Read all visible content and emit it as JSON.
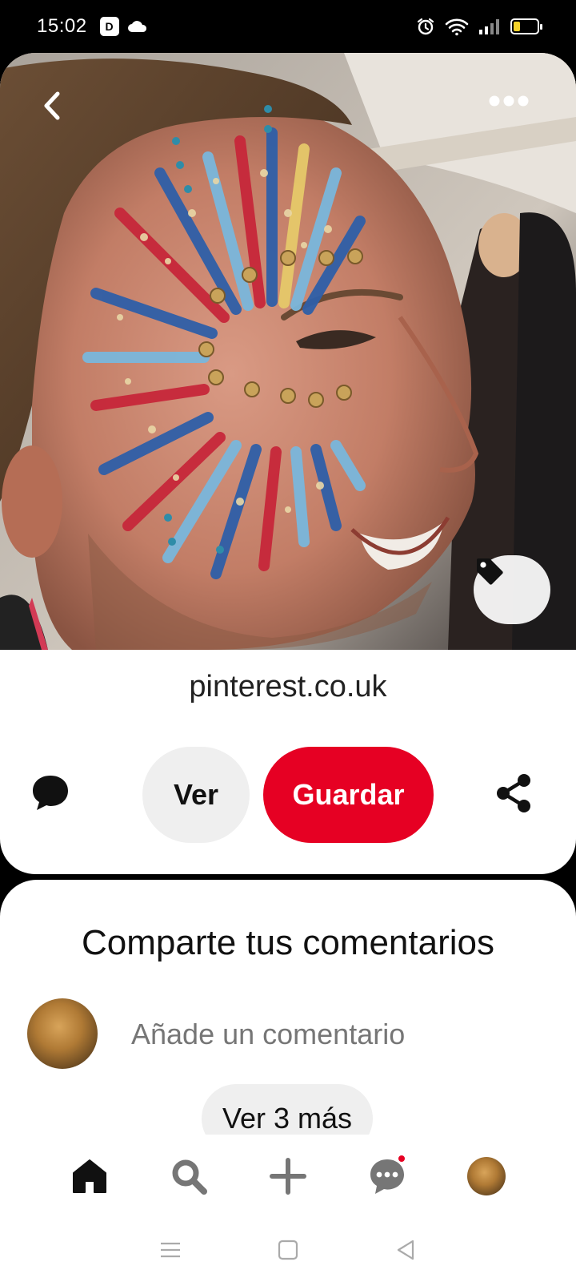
{
  "status_bar": {
    "time": "15:02",
    "battery_level": 0.3
  },
  "pin": {
    "source": "pinterest.co.uk",
    "view_label": "Ver",
    "save_label": "Guardar"
  },
  "comments": {
    "title": "Comparte tus comentarios",
    "input_placeholder": "Añade un comentario",
    "more_label": "Ver 3 más"
  },
  "colors": {
    "brand_red": "#e60023",
    "button_gray": "#efefef",
    "battery_yellow": "#f5d32a"
  },
  "icons": {
    "back": "chevron-left-icon",
    "more": "more-horizontal-icon",
    "tag": "tag-icon",
    "comment": "speech-bubble-icon",
    "share": "share-icon",
    "nav_home": "home-icon",
    "nav_search": "search-icon",
    "nav_create": "plus-icon",
    "nav_messages": "chat-icon"
  }
}
